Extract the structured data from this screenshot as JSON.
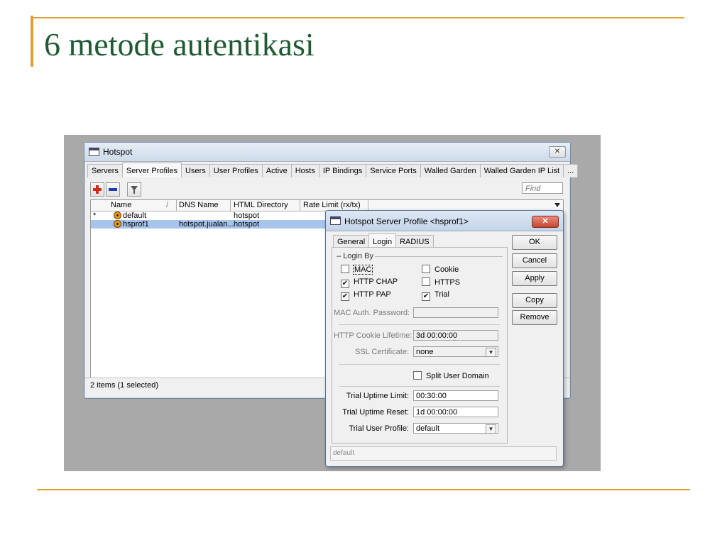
{
  "slide": {
    "title": "6 metode autentikasi",
    "accent_color": "#e0a030",
    "title_color": "#1f5a32"
  },
  "window": {
    "title": "Hotspot",
    "tabs": [
      "Servers",
      "Server Profiles",
      "Users",
      "User Profiles",
      "Active",
      "Hosts",
      "IP Bindings",
      "Service Ports",
      "Walled Garden",
      "Walled Garden IP List",
      "..."
    ],
    "active_tab": "Server Profiles",
    "find_placeholder": "Find",
    "columns": [
      "Name",
      "/",
      "DNS Name",
      "HTML Directory",
      "Rate Limit (rx/tx)"
    ],
    "rows": [
      {
        "marker": "*",
        "name": "default",
        "dns": "",
        "html": "hotspot",
        "selected": false
      },
      {
        "marker": "",
        "name": "hsprof1",
        "dns": "hotspot.jualan...",
        "html": "hotspot",
        "selected": true
      }
    ],
    "status": "2 items (1 selected)"
  },
  "dialog": {
    "title": "Hotspot Server Profile <hsprof1>",
    "tabs": [
      "General",
      "Login",
      "RADIUS"
    ],
    "active_tab": "Login",
    "group": "Login By",
    "checks": {
      "mac": {
        "label": "MAC",
        "checked": false
      },
      "cookie": {
        "label": "Cookie",
        "checked": false
      },
      "http_chap": {
        "label": "HTTP CHAP",
        "checked": true
      },
      "https": {
        "label": "HTTPS",
        "checked": false
      },
      "http_pap": {
        "label": "HTTP PAP",
        "checked": true
      },
      "trial": {
        "label": "Trial",
        "checked": true
      },
      "split": {
        "label": "Split User Domain",
        "checked": false
      }
    },
    "fields": {
      "mac_pw_label": "MAC Auth. Password:",
      "mac_pw_value": "",
      "cookie_label": "HTTP Cookie Lifetime:",
      "cookie_value": "3d 00:00:00",
      "ssl_label": "SSL Certificate:",
      "ssl_value": "none",
      "trial_uptime_label": "Trial Uptime Limit:",
      "trial_uptime_value": "00:30:00",
      "trial_reset_label": "Trial Uptime Reset:",
      "trial_reset_value": "1d 00:00:00",
      "trial_profile_label": "Trial User Profile:",
      "trial_profile_value": "default"
    },
    "buttons": {
      "ok": "OK",
      "cancel": "Cancel",
      "apply": "Apply",
      "copy": "Copy",
      "remove": "Remove"
    },
    "status": "default"
  }
}
